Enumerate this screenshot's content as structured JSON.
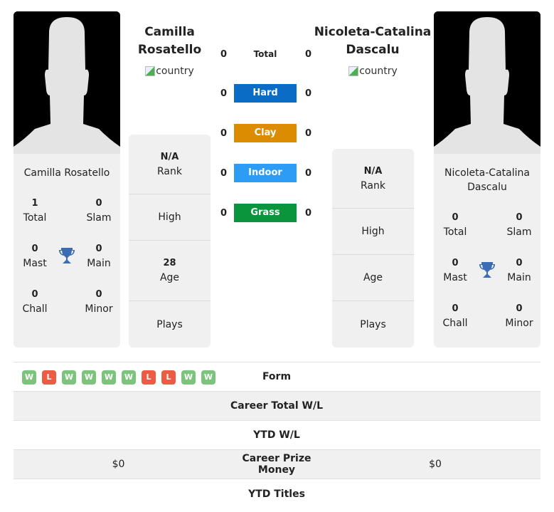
{
  "player1": {
    "name": "Camilla Rosatello",
    "name_line1": "Camilla",
    "name_line2": "Rosatello",
    "country_alt": "country",
    "card_name": "Camilla Rosatello",
    "titles": {
      "total": {
        "value": "1",
        "label": "Total"
      },
      "slam": {
        "value": "0",
        "label": "Slam"
      },
      "mast": {
        "value": "0",
        "label": "Mast"
      },
      "main": {
        "value": "0",
        "label": "Main"
      },
      "chall": {
        "value": "0",
        "label": "Chall"
      },
      "minor": {
        "value": "0",
        "label": "Minor"
      }
    },
    "info": {
      "rank_value": "N/A",
      "rank_label": "Rank",
      "high_label": "High",
      "age_value": "28",
      "age_label": "Age",
      "plays_label": "Plays"
    }
  },
  "player2": {
    "name": "Nicoleta-Catalina Dascalu",
    "name_line1": "Nicoleta-Catalina",
    "name_line2": "Dascalu",
    "country_alt": "country",
    "card_name_line1": "Nicoleta-Catalina",
    "card_name_line2": "Dascalu",
    "titles": {
      "total": {
        "value": "0",
        "label": "Total"
      },
      "slam": {
        "value": "0",
        "label": "Slam"
      },
      "mast": {
        "value": "0",
        "label": "Mast"
      },
      "main": {
        "value": "0",
        "label": "Main"
      },
      "chall": {
        "value": "0",
        "label": "Chall"
      },
      "minor": {
        "value": "0",
        "label": "Minor"
      }
    },
    "info": {
      "rank_value": "N/A",
      "rank_label": "Rank",
      "high_label": "High",
      "age_label": "Age",
      "plays_label": "Plays"
    }
  },
  "surfaces": [
    {
      "label": "Total",
      "p1": "0",
      "p2": "0",
      "color": null
    },
    {
      "label": "Hard",
      "p1": "0",
      "p2": "0",
      "color": "#0a6cc4"
    },
    {
      "label": "Clay",
      "p1": "0",
      "p2": "0",
      "color": "#dc8c00"
    },
    {
      "label": "Indoor",
      "p1": "0",
      "p2": "0",
      "color": "#2c9cf4"
    },
    {
      "label": "Grass",
      "p1": "0",
      "p2": "0",
      "color": "#0a943c"
    }
  ],
  "form": {
    "label": "Form",
    "results": [
      "W",
      "L",
      "W",
      "W",
      "W",
      "W",
      "L",
      "L",
      "W",
      "W"
    ],
    "colors": {
      "W": "#7cc47c",
      "L": "#ec5c44"
    }
  },
  "table": [
    {
      "label": "Career Total W/L",
      "p1": "",
      "p2": ""
    },
    {
      "label": "YTD W/L",
      "p1": "",
      "p2": ""
    },
    {
      "label": "Career Prize Money",
      "p1": "$0",
      "p2": "$0"
    },
    {
      "label": "YTD Titles",
      "p1": "",
      "p2": ""
    }
  ],
  "colors": {
    "trophy": "#3c6cb4",
    "card_bg": "#f0f0f0"
  }
}
